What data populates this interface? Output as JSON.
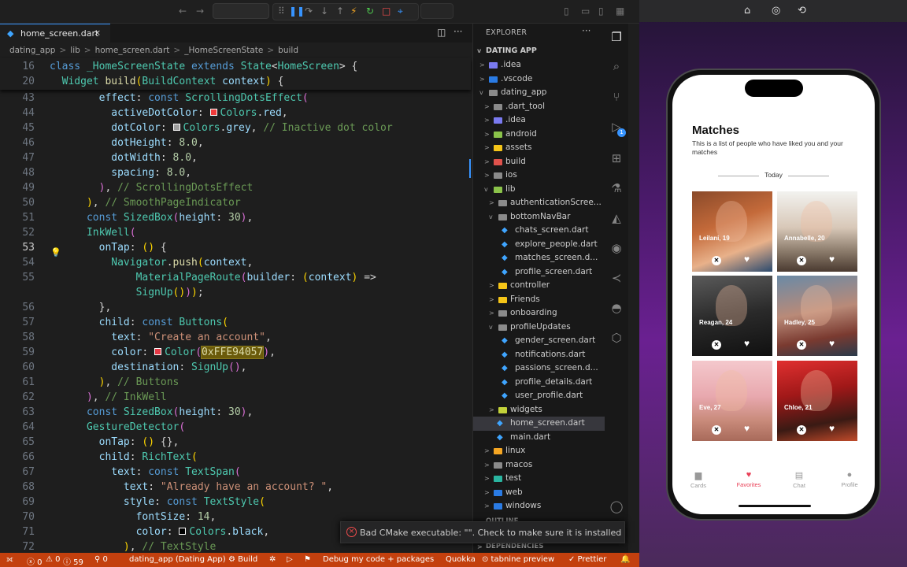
{
  "tab": {
    "label": "home_screen.dart",
    "close": "×"
  },
  "breadcrumb": [
    "dating_app",
    ">",
    "lib",
    ">",
    "home_screen.dart",
    ">",
    "_HomeScreenState",
    ">",
    "build"
  ],
  "sticky": [
    {
      "n": "16",
      "t": [
        [
          "k",
          "class "
        ],
        [
          "c",
          "_HomeScreenState "
        ],
        [
          "k",
          "extends "
        ],
        [
          "c",
          "State"
        ],
        [
          "w",
          "<"
        ],
        [
          "c",
          "HomeScreen"
        ],
        [
          "w",
          "> {"
        ]
      ]
    },
    {
      "n": "20",
      "t": [
        [
          "c",
          "  Widget "
        ],
        [
          "f",
          "build"
        ],
        [
          "y",
          "("
        ],
        [
          "c",
          "BuildContext "
        ],
        [
          "p",
          "context"
        ],
        [
          "y",
          ") "
        ],
        [
          "w",
          "{"
        ]
      ]
    }
  ],
  "code_lines": [
    {
      "n": "43",
      "t": [
        [
          "p",
          "            effect"
        ],
        [
          "w",
          ": "
        ],
        [
          "k",
          "const "
        ],
        [
          "c",
          "ScrollingDotsEffect"
        ],
        [
          "pk",
          "("
        ]
      ]
    },
    {
      "n": "44",
      "t": [
        [
          "p",
          "              activeDotColor"
        ],
        [
          "w",
          ": "
        ],
        [
          "sw",
          "#f03a3a"
        ],
        [
          "c",
          "Colors"
        ],
        [
          "w",
          "."
        ],
        [
          "p",
          "red"
        ],
        [
          "w",
          ","
        ]
      ]
    },
    {
      "n": "45",
      "t": [
        [
          "p",
          "              dotColor"
        ],
        [
          "w",
          ": "
        ],
        [
          "sw",
          "#9e9e9e"
        ],
        [
          "c",
          "Colors"
        ],
        [
          "w",
          "."
        ],
        [
          "p",
          "grey"
        ],
        [
          "w",
          ", "
        ],
        [
          "cm",
          "// Inactive dot color"
        ]
      ]
    },
    {
      "n": "46",
      "t": [
        [
          "p",
          "              dotHeight"
        ],
        [
          "w",
          ": "
        ],
        [
          "n",
          "8.0"
        ],
        [
          "w",
          ","
        ]
      ]
    },
    {
      "n": "47",
      "t": [
        [
          "p",
          "              dotWidth"
        ],
        [
          "w",
          ": "
        ],
        [
          "n",
          "8.0"
        ],
        [
          "w",
          ","
        ]
      ]
    },
    {
      "n": "48",
      "t": [
        [
          "p",
          "              spacing"
        ],
        [
          "w",
          ": "
        ],
        [
          "n",
          "8.0"
        ],
        [
          "w",
          ","
        ]
      ]
    },
    {
      "n": "49",
      "t": [
        [
          "pk",
          "            )"
        ],
        [
          "w",
          ", "
        ],
        [
          "cm",
          "// ScrollingDotsEffect"
        ]
      ]
    },
    {
      "n": "50",
      "t": [
        [
          "y",
          "          )"
        ],
        [
          "w",
          ", "
        ],
        [
          "cm",
          "// SmoothPageIndicator"
        ]
      ]
    },
    {
      "n": "51",
      "t": [
        [
          "k",
          "          const "
        ],
        [
          "c",
          "SizedBox"
        ],
        [
          "pk",
          "("
        ],
        [
          "p",
          "height"
        ],
        [
          "w",
          ": "
        ],
        [
          "n",
          "30"
        ],
        [
          "pk",
          ")"
        ],
        [
          "w",
          ","
        ]
      ]
    },
    {
      "n": "52",
      "t": [
        [
          "c",
          "          InkWell"
        ],
        [
          "pk",
          "("
        ]
      ]
    },
    {
      "n": "53",
      "t": [
        [
          "p",
          "            onTap"
        ],
        [
          "w",
          ": "
        ],
        [
          "y",
          "() "
        ],
        [
          "w",
          "{"
        ]
      ]
    },
    {
      "n": "54",
      "t": [
        [
          "c",
          "              Navigator"
        ],
        [
          "w",
          "."
        ],
        [
          "f",
          "push"
        ],
        [
          "y",
          "("
        ],
        [
          "p",
          "context"
        ],
        [
          "w",
          ","
        ]
      ]
    },
    {
      "n": "55",
      "t": [
        [
          "c",
          "                  MaterialPageRoute"
        ],
        [
          "pk",
          "("
        ],
        [
          "p",
          "builder"
        ],
        [
          "w",
          ": "
        ],
        [
          "y",
          "("
        ],
        [
          "p",
          "context"
        ],
        [
          "y",
          ") "
        ],
        [
          "w",
          "=>"
        ]
      ]
    },
    {
      "n": "",
      "t": [
        [
          "c",
          "                  SignUp"
        ],
        [
          "y",
          "()"
        ],
        [
          "pk",
          ")"
        ],
        [
          "y",
          ")"
        ],
        [
          "w",
          ";"
        ]
      ]
    },
    {
      "n": "56",
      "t": [
        [
          "w",
          "            },"
        ]
      ]
    },
    {
      "n": "57",
      "t": [
        [
          "p",
          "            child"
        ],
        [
          "w",
          ": "
        ],
        [
          "k",
          "const "
        ],
        [
          "c",
          "Buttons"
        ],
        [
          "y",
          "("
        ]
      ]
    },
    {
      "n": "58",
      "t": [
        [
          "p",
          "              text"
        ],
        [
          "w",
          ": "
        ],
        [
          "s",
          "\"Create an account\""
        ],
        [
          "w",
          ","
        ]
      ]
    },
    {
      "n": "59",
      "t": [
        [
          "p",
          "              color"
        ],
        [
          "w",
          ": "
        ],
        [
          "sw",
          "#e63946"
        ],
        [
          "c",
          "Color"
        ],
        [
          "pk",
          "("
        ],
        [
          "hl",
          "0xFFE94057"
        ],
        [
          "pk",
          ")"
        ],
        [
          "w",
          ","
        ]
      ]
    },
    {
      "n": "60",
      "t": [
        [
          "p",
          "              destination"
        ],
        [
          "w",
          ": "
        ],
        [
          "c",
          "SignUp"
        ],
        [
          "pk",
          "()"
        ],
        [
          "w",
          ","
        ]
      ]
    },
    {
      "n": "61",
      "t": [
        [
          "y",
          "            )"
        ],
        [
          "w",
          ", "
        ],
        [
          "cm",
          "// Buttons"
        ]
      ]
    },
    {
      "n": "62",
      "t": [
        [
          "pk",
          "          )"
        ],
        [
          "w",
          ", "
        ],
        [
          "cm",
          "// InkWell"
        ]
      ]
    },
    {
      "n": "63",
      "t": [
        [
          "k",
          "          const "
        ],
        [
          "c",
          "SizedBox"
        ],
        [
          "pk",
          "("
        ],
        [
          "p",
          "height"
        ],
        [
          "w",
          ": "
        ],
        [
          "n",
          "30"
        ],
        [
          "pk",
          ")"
        ],
        [
          "w",
          ","
        ]
      ]
    },
    {
      "n": "64",
      "t": [
        [
          "c",
          "          GestureDetector"
        ],
        [
          "pk",
          "("
        ]
      ]
    },
    {
      "n": "65",
      "t": [
        [
          "p",
          "            onTap"
        ],
        [
          "w",
          ": "
        ],
        [
          "y",
          "() "
        ],
        [
          "w",
          "{},"
        ]
      ]
    },
    {
      "n": "66",
      "t": [
        [
          "p",
          "            child"
        ],
        [
          "w",
          ": "
        ],
        [
          "c",
          "RichText"
        ],
        [
          "y",
          "("
        ]
      ]
    },
    {
      "n": "67",
      "t": [
        [
          "p",
          "              text"
        ],
        [
          "w",
          ": "
        ],
        [
          "k",
          "const "
        ],
        [
          "c",
          "TextSpan"
        ],
        [
          "pk",
          "("
        ]
      ]
    },
    {
      "n": "68",
      "t": [
        [
          "p",
          "                text"
        ],
        [
          "w",
          ": "
        ],
        [
          "s",
          "\"Already have an account? \""
        ],
        [
          "w",
          ","
        ]
      ]
    },
    {
      "n": "69",
      "t": [
        [
          "p",
          "                style"
        ],
        [
          "w",
          ": "
        ],
        [
          "k",
          "const "
        ],
        [
          "c",
          "TextStyle"
        ],
        [
          "y",
          "("
        ]
      ]
    },
    {
      "n": "70",
      "t": [
        [
          "p",
          "                  fontSize"
        ],
        [
          "w",
          ": "
        ],
        [
          "n",
          "14"
        ],
        [
          "w",
          ","
        ]
      ]
    },
    {
      "n": "71",
      "t": [
        [
          "p",
          "                  color"
        ],
        [
          "w",
          ": "
        ],
        [
          "sw",
          "#000000"
        ],
        [
          "c",
          "Colors"
        ],
        [
          "w",
          "."
        ],
        [
          "p",
          "black"
        ],
        [
          "w",
          ","
        ]
      ]
    },
    {
      "n": "72",
      "t": [
        [
          "y",
          "                )"
        ],
        [
          "w",
          ", "
        ],
        [
          "cm",
          "// TextStyle"
        ]
      ]
    }
  ],
  "explorer": {
    "title": "EXPLORER",
    "project": "DATING APP",
    "more": "···"
  },
  "tree": [
    {
      "d": 1,
      "a": ">",
      "t": "f",
      "c": "#7a7af0",
      "l": ".idea"
    },
    {
      "d": 1,
      "a": ">",
      "t": "f",
      "c": "#2a7be4",
      "l": ".vscode"
    },
    {
      "d": 1,
      "a": "v",
      "t": "f",
      "c": "#8b8b8b",
      "l": "dating_app"
    },
    {
      "d": 2,
      "a": ">",
      "t": "f",
      "c": "#8b8b8b",
      "l": ".dart_tool"
    },
    {
      "d": 2,
      "a": ">",
      "t": "f",
      "c": "#7a7af0",
      "l": ".idea"
    },
    {
      "d": 2,
      "a": ">",
      "t": "f",
      "c": "#8bc34a",
      "l": "android"
    },
    {
      "d": 2,
      "a": ">",
      "t": "f",
      "c": "#f5c518",
      "l": "assets"
    },
    {
      "d": 2,
      "a": ">",
      "t": "f",
      "c": "#e0524c",
      "l": "build"
    },
    {
      "d": 2,
      "a": ">",
      "t": "f",
      "c": "#8b8b8b",
      "l": "ios"
    },
    {
      "d": 2,
      "a": "v",
      "t": "f",
      "c": "#8bc34a",
      "l": "lib"
    },
    {
      "d": 3,
      "a": ">",
      "t": "f",
      "c": "#8b8b8b",
      "l": "authenticationScree..."
    },
    {
      "d": 3,
      "a": "v",
      "t": "f",
      "c": "#8b8b8b",
      "l": "bottomNavBar"
    },
    {
      "d": 4,
      "a": "",
      "t": "d",
      "l": "chats_screen.dart"
    },
    {
      "d": 4,
      "a": "",
      "t": "d",
      "l": "explore_people.dart"
    },
    {
      "d": 4,
      "a": "",
      "t": "d",
      "l": "matches_screen.d..."
    },
    {
      "d": 4,
      "a": "",
      "t": "d",
      "l": "profile_screen.dart"
    },
    {
      "d": 3,
      "a": ">",
      "t": "f",
      "c": "#f5c518",
      "l": "controller"
    },
    {
      "d": 3,
      "a": ">",
      "t": "f",
      "c": "#f5c518",
      "l": "Friends"
    },
    {
      "d": 3,
      "a": ">",
      "t": "f",
      "c": "#8b8b8b",
      "l": "onboarding"
    },
    {
      "d": 3,
      "a": "v",
      "t": "f",
      "c": "#8b8b8b",
      "l": "profileUpdates"
    },
    {
      "d": 4,
      "a": "",
      "t": "d",
      "l": "gender_screen.dart"
    },
    {
      "d": 4,
      "a": "",
      "t": "d",
      "l": "notifications.dart"
    },
    {
      "d": 4,
      "a": "",
      "t": "d",
      "l": "passions_screen.d..."
    },
    {
      "d": 4,
      "a": "",
      "t": "d",
      "l": "profile_details.dart"
    },
    {
      "d": 4,
      "a": "",
      "t": "d",
      "l": "user_profile.dart"
    },
    {
      "d": 3,
      "a": ">",
      "t": "f",
      "c": "#c3d23a",
      "l": "widgets"
    },
    {
      "d": 3,
      "a": "",
      "t": "d",
      "l": "home_screen.dart",
      "sel": true
    },
    {
      "d": 3,
      "a": "",
      "t": "d",
      "l": "main.dart"
    },
    {
      "d": 2,
      "a": ">",
      "t": "f",
      "c": "#f5a623",
      "l": "linux"
    },
    {
      "d": 2,
      "a": ">",
      "t": "f",
      "c": "#8b8b8b",
      "l": "macos"
    },
    {
      "d": 2,
      "a": ">",
      "t": "f",
      "c": "#2ab5a0",
      "l": "test"
    },
    {
      "d": 2,
      "a": ">",
      "t": "f",
      "c": "#2a7be4",
      "l": "web"
    },
    {
      "d": 2,
      "a": ">",
      "t": "f",
      "c": "#2a7be4",
      "l": "windows"
    }
  ],
  "collapsed": {
    "outline": "OUTLINE",
    "deps": "DEPENDENCIES"
  },
  "notification": "Bad CMake executable: \"\". Check to make sure it is installed or the...",
  "status": {
    "errors": "ⓧ 0",
    "warnings": "⚠ 0",
    "info": "ⓘ 59",
    "ports": "⚲ 0",
    "app": "dating_app (Dating App)",
    "build": "⚙ Build",
    "debug": "Debug my code + packages",
    "quokka": "Quokka",
    "tabnine": "⊙ tabnine preview",
    "prettier": "✓ Prettier"
  },
  "app": {
    "title": "Matches",
    "subtitle": "This is a list of people who have liked you and your matches",
    "divider": "Today",
    "cards": [
      {
        "name": "Leilani, 19",
        "g": "linear-gradient(160deg,#8a4a2a,#c46a3a 40%,#e8b18a 70%,#2b4a6e)"
      },
      {
        "name": "Annabelle, 20",
        "g": "linear-gradient(180deg,#f2f2ef,#d8c8b8 45%,#8a7a6a 75%,#4a3a30)"
      },
      {
        "name": "Reagan, 24",
        "g": "linear-gradient(170deg,#5a5a5a,#2a2a2a 50%,#101010)"
      },
      {
        "name": "Hadley, 25",
        "g": "linear-gradient(170deg,#6a8aa6,#b98a78 45%,#7a3a30 75%,#2a3a4a)"
      },
      {
        "name": "Eve, 27",
        "g": "linear-gradient(180deg,#f4c8cc,#e8a8ae 45%,#c88a7a 75%,#a86a5a)"
      },
      {
        "name": "Chloe, 21",
        "g": "linear-gradient(170deg,#e03030,#a01818 40%,#3a1a14 75%,#c04a2a)"
      }
    ],
    "nav": [
      {
        "label": "Cards",
        "icon": "▆"
      },
      {
        "label": "Favorites",
        "icon": "♥",
        "active": true
      },
      {
        "label": "Chat",
        "icon": "▤"
      },
      {
        "label": "Profile",
        "icon": "●"
      }
    ],
    "active_color": "#e94057"
  }
}
